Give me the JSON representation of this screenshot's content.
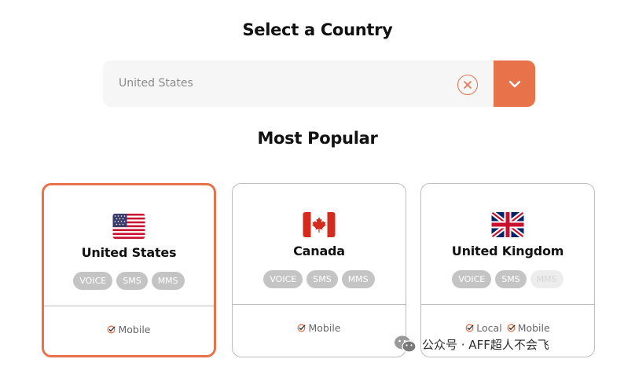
{
  "page": {
    "title": "Select a Country",
    "subtitle": "Most Popular"
  },
  "select": {
    "value": "United States",
    "clear_icon": "clear-x-circle-icon",
    "dropdown_icon": "chevron-down-icon"
  },
  "cards": [
    {
      "name": "United States",
      "flag": "us-flag-icon",
      "selected": true,
      "badges": [
        "VOICE",
        "SMS",
        "MMS"
      ],
      "footer": [
        "Mobile"
      ]
    },
    {
      "name": "Canada",
      "flag": "canada-flag-icon",
      "selected": false,
      "badges": [
        "VOICE",
        "SMS",
        "MMS"
      ],
      "footer": [
        "Mobile"
      ]
    },
    {
      "name": "United Kingdom",
      "flag": "uk-flag-icon",
      "selected": false,
      "badges": [
        "VOICE",
        "SMS",
        "MMS"
      ],
      "disabled_badges": [
        "MMS"
      ],
      "footer": [
        "Local",
        "Mobile"
      ]
    }
  ],
  "watermark": {
    "text": "公众号 · AFF超人不会飞",
    "icon": "wechat-icon"
  },
  "colors": {
    "accent": "#e8724a",
    "badge": "#c4c4c4",
    "badge_disabled": "#ededed",
    "input_bg": "#f6f6f6"
  }
}
